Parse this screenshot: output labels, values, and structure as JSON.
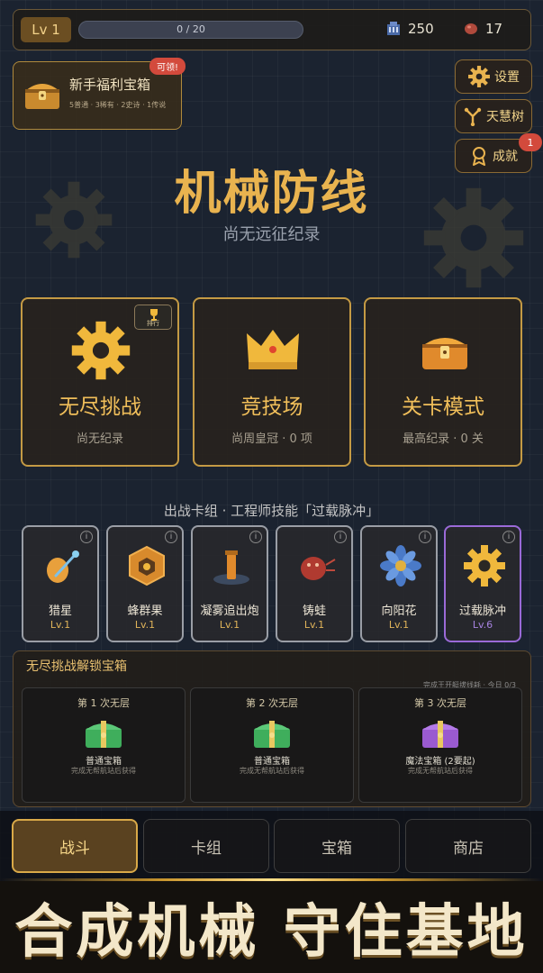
{
  "topbar": {
    "level": "Lv 1",
    "xp_text": "0 / 20",
    "xp_fraction": 0,
    "currency_a": "250",
    "currency_b": "17"
  },
  "newbie_chest": {
    "title": "新手福利宝箱",
    "subtitle": "5普通 · 3稀有 · 2史诗 · 1传说",
    "badge": "可领!"
  },
  "side_buttons": {
    "settings": "设置",
    "tech_tree": "天慧树",
    "achievements": "成就",
    "achievements_badge": "1"
  },
  "header": {
    "title": "机械防线",
    "subtitle": "尚无远征纪录"
  },
  "modes": [
    {
      "name": "无尽挑战",
      "sub": "尚无纪录",
      "rank_label": "排行"
    },
    {
      "name": "竞技场",
      "sub": "尚周皇冠 · 0 项"
    },
    {
      "name": "关卡模式",
      "sub": "最高纪录 · 0 关"
    }
  ],
  "deck": {
    "label": "出战卡组 · 工程师技能「过载脉冲」",
    "cards": [
      {
        "name": "猎星",
        "level": "Lv.1"
      },
      {
        "name": "蜂群果",
        "level": "Lv.1"
      },
      {
        "name": "凝雾追出炮",
        "level": "Lv.1"
      },
      {
        "name": "铸蛙",
        "level": "Lv.1"
      },
      {
        "name": "向阳花",
        "level": "Lv.1"
      },
      {
        "name": "过载脉冲",
        "level": "Lv.6"
      }
    ]
  },
  "unlock": {
    "title": "无尽挑战解锁宝箱",
    "note": "完成王开艇拔线耗 · 今日 0/3",
    "boxes": [
      {
        "head": "第 1 次无层",
        "name": "普通宝箱",
        "desc": "完成无帮航站后获得"
      },
      {
        "head": "第 2 次无层",
        "name": "普通宝箱",
        "desc": "完成无帮航站后获得"
      },
      {
        "head": "第 3 次无层",
        "name": "魔法宝箱 (2要起)",
        "desc": "完成无帮航站后获得"
      }
    ]
  },
  "tabs": [
    "战斗",
    "卡组",
    "宝箱",
    "商店"
  ],
  "banner": "合成机械 守住基地",
  "colors": {
    "accent": "#e9b34f",
    "background": "#1b2330",
    "badge_red": "#d34a3c",
    "rare_purple": "#9a6ad8"
  }
}
